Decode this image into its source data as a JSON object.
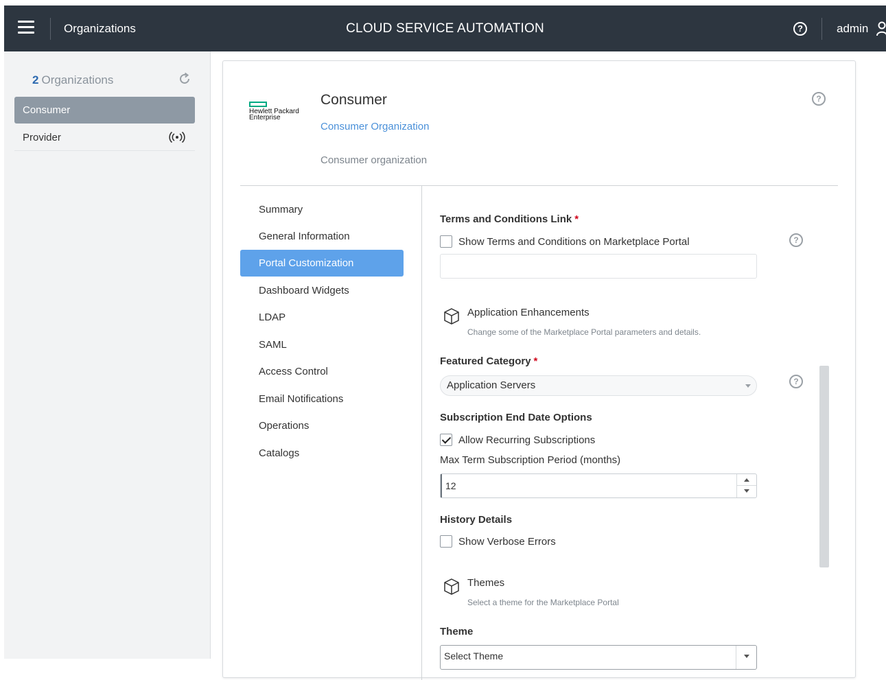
{
  "header": {
    "section_title": "Organizations",
    "app_title": "CLOUD SERVICE AUTOMATION",
    "help_glyph": "?",
    "user_name": "admin"
  },
  "sidebar": {
    "count": "2",
    "count_label": "Organizations",
    "items": [
      {
        "label": "Consumer",
        "selected": true
      },
      {
        "label": "Provider",
        "selected": false
      }
    ]
  },
  "org": {
    "logo_text_line1": "Hewlett Packard",
    "logo_text_line2": "Enterprise",
    "name": "Consumer",
    "subtitle": "Consumer Organization",
    "description": "Consumer organization"
  },
  "nav": {
    "items": [
      "Summary",
      "General Information",
      "Portal Customization",
      "Dashboard Widgets",
      "LDAP",
      "SAML",
      "Access Control",
      "Email Notifications",
      "Operations",
      "Catalogs"
    ],
    "active": "Portal Customization"
  },
  "form": {
    "help_glyph": "?",
    "required_mark": "*",
    "terms_label": "Terms and Conditions Link",
    "terms_checkbox_label": "Show Terms and Conditions on Marketplace Portal",
    "terms_checkbox_checked": false,
    "terms_value": "",
    "app_enh_title": "Application Enhancements",
    "app_enh_sub": "Change some of the Marketplace Portal parameters and details.",
    "featured_label": "Featured Category",
    "featured_value": "Application Servers",
    "subscription_label": "Subscription End Date Options",
    "recurring_label": "Allow Recurring Subscriptions",
    "recurring_checked": true,
    "max_term_label": "Max Term Subscription Period (months)",
    "max_term_value": "12",
    "history_label": "History Details",
    "verbose_label": "Show Verbose Errors",
    "verbose_checked": false,
    "themes_title": "Themes",
    "themes_sub": "Select a theme for the Marketplace Portal",
    "theme_label": "Theme",
    "theme_value": "Select Theme"
  },
  "colors": {
    "topbar": "#2d3640",
    "accent": "#5ea2ea",
    "link": "#4a90d9",
    "required": "#d0021b",
    "hpe_green": "#01a982"
  }
}
